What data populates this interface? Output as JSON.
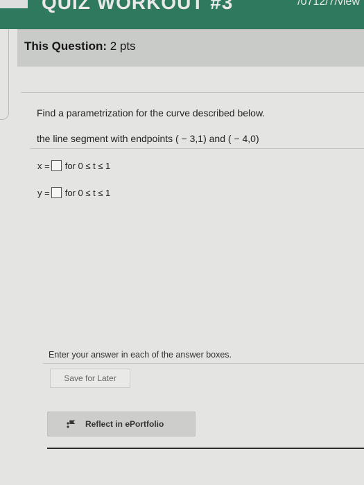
{
  "header": {
    "blurred_title": "QUIZ WORKOUT #3",
    "blurred_url_tail": "/0712/7/view"
  },
  "question": {
    "label": "This Question:",
    "points": "2 pts"
  },
  "problem": {
    "prompt": "Find a parametrization for the curve described below.",
    "description": "the line segment with endpoints ( − 3,1) and ( − 4,0)",
    "x_row": {
      "lhs": "x =",
      "range": "for 0 ≤ t ≤ 1"
    },
    "y_row": {
      "lhs": "y =",
      "range": "for 0 ≤ t ≤ 1"
    }
  },
  "instructions": "Enter your answer in each of the answer boxes.",
  "buttons": {
    "save": "Save for Later",
    "reflect": "Reflect in ePortfolio"
  },
  "colors": {
    "header_green": "#2f7a5e",
    "question_header_bg": "#c9cbc8"
  }
}
